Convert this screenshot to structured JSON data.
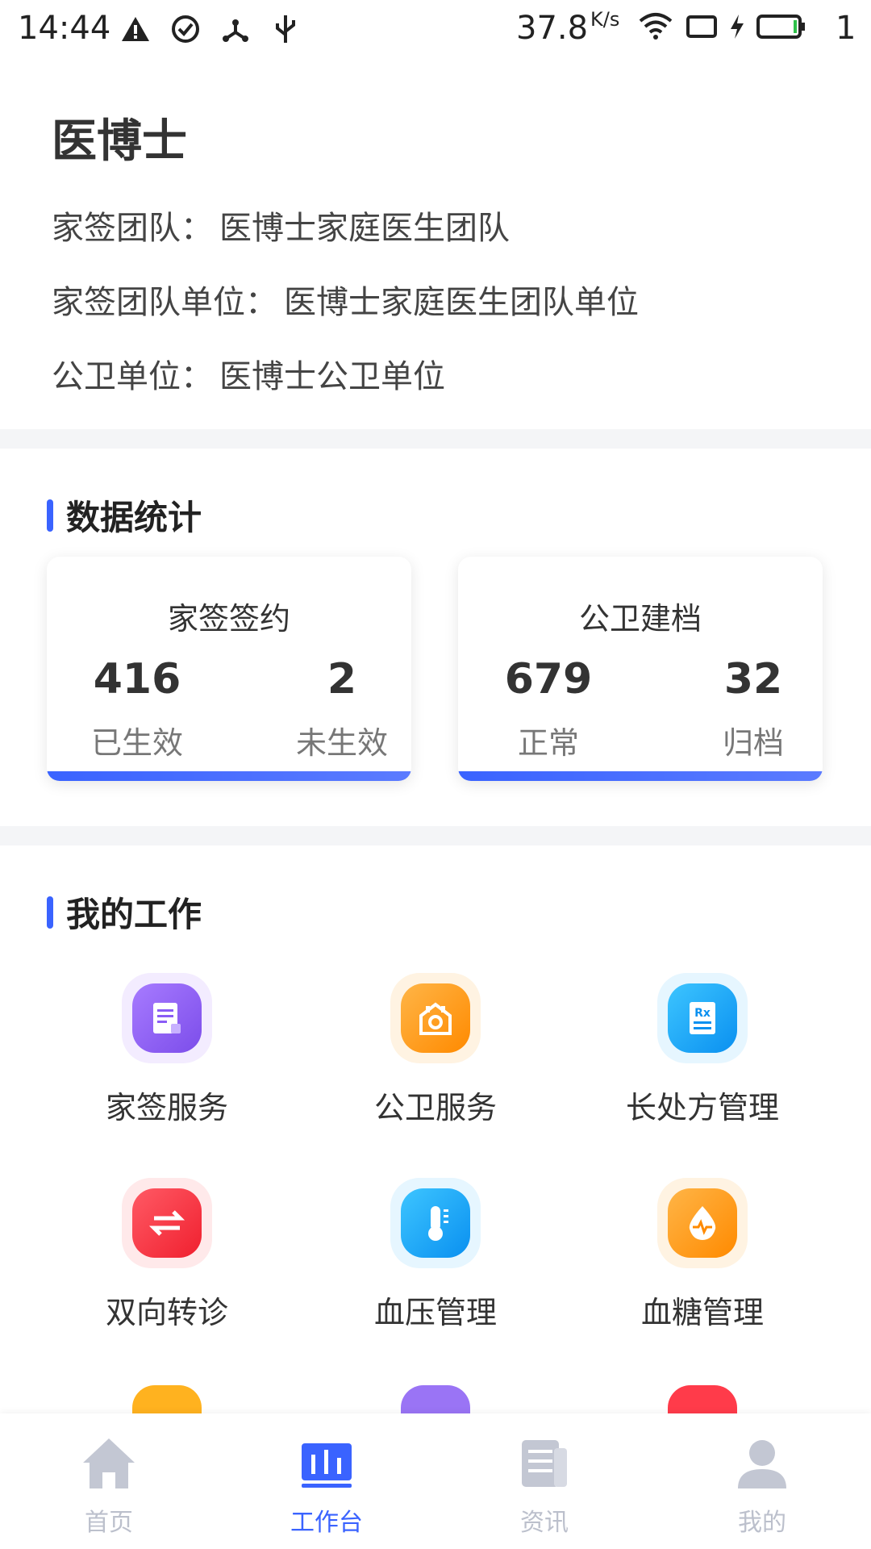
{
  "status_bar": {
    "time": "14:44",
    "speed": "37.8",
    "speed_unit": "K/s",
    "battery_level": "1",
    "icons_left": [
      "warning-icon",
      "check-circle-icon",
      "share-node-icon",
      "usb-icon"
    ],
    "icons_right": [
      "wifi-icon",
      "screen-icon",
      "charging-icon",
      "battery-icon"
    ]
  },
  "header": {
    "title": "医博士",
    "lines": [
      {
        "label": "家签团队：",
        "value": "医博士家庭医生团队"
      },
      {
        "label": "家签团队单位：",
        "value": "医博士家庭医生团队单位"
      },
      {
        "label": "公卫单位：",
        "value": "医博士公卫单位"
      }
    ]
  },
  "stats": {
    "section_title": "数据统计",
    "cards": [
      {
        "title": "家签签约",
        "items": [
          {
            "value": "416",
            "label": "已生效"
          },
          {
            "value": "2",
            "label": "未生效"
          }
        ]
      },
      {
        "title": "公卫建档",
        "items": [
          {
            "value": "679",
            "label": "正常"
          },
          {
            "value": "32",
            "label": "归档"
          }
        ]
      }
    ]
  },
  "work": {
    "section_title": "我的工作",
    "items": [
      {
        "label": "家签服务",
        "icon": "document-icon",
        "color": "#8a5cf6"
      },
      {
        "label": "公卫服务",
        "icon": "house-icon",
        "color": "#ff9a1f"
      },
      {
        "label": "长处方管理",
        "icon": "prescription-icon",
        "color": "#1aa8ff"
      },
      {
        "label": "双向转诊",
        "icon": "transfer-icon",
        "color": "#ff3b4a"
      },
      {
        "label": "血压管理",
        "icon": "thermometer-icon",
        "color": "#1aa8ff"
      },
      {
        "label": "血糖管理",
        "icon": "drop-pulse-icon",
        "color": "#ff9a1f"
      }
    ],
    "partial_colors": [
      "#ffb21f",
      "#8a5cf6",
      "#ff3b4a"
    ]
  },
  "tabbar": {
    "tabs": [
      {
        "label": "首页",
        "icon": "home-icon",
        "active": false
      },
      {
        "label": "工作台",
        "icon": "chart-icon",
        "active": true
      },
      {
        "label": "资讯",
        "icon": "news-icon",
        "active": false
      },
      {
        "label": "我的",
        "icon": "user-icon",
        "active": false
      }
    ],
    "active_color": "#3a63ff",
    "inactive_color": "#bcc0cc"
  }
}
